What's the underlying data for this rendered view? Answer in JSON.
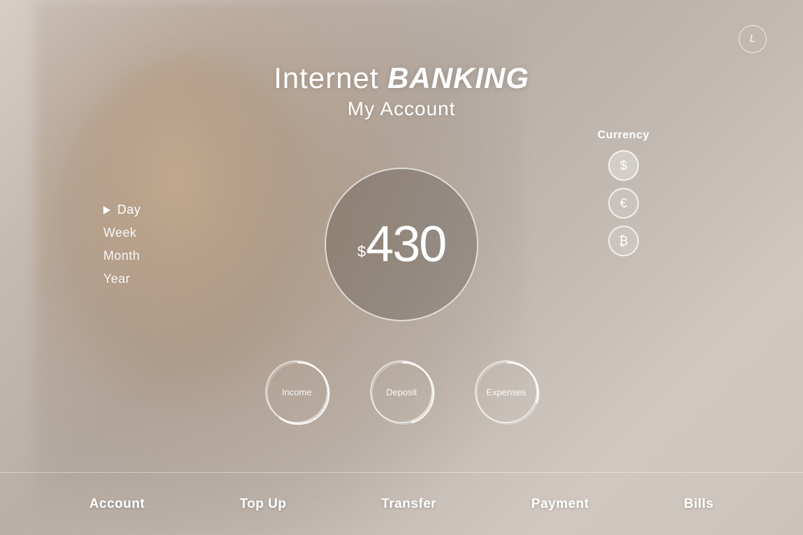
{
  "logo": {
    "icon": "L"
  },
  "title": {
    "line1_prefix": "Internet ",
    "line1_bold": "BANKING",
    "line2": "My Account"
  },
  "left_nav": {
    "items": [
      {
        "label": "Day",
        "active": true
      },
      {
        "label": "Week",
        "active": false
      },
      {
        "label": "Month",
        "active": false
      },
      {
        "label": "Year",
        "active": false
      }
    ]
  },
  "balance": {
    "currency_symbol": "$",
    "amount": "430"
  },
  "currency_panel": {
    "label": "Currency",
    "options": [
      {
        "symbol": "$",
        "active": true
      },
      {
        "symbol": "€",
        "active": false
      },
      {
        "symbol": "₿",
        "active": false
      }
    ]
  },
  "stat_circles": [
    {
      "label": "Income",
      "progress": 0.6
    },
    {
      "label": "Deposit",
      "progress": 0.45
    },
    {
      "label": "Expenses",
      "progress": 0.3
    }
  ],
  "bottom_nav": {
    "items": [
      {
        "label": "Account"
      },
      {
        "label": "Top Up"
      },
      {
        "label": "Transfer"
      },
      {
        "label": "Payment"
      },
      {
        "label": "Bills"
      }
    ]
  }
}
